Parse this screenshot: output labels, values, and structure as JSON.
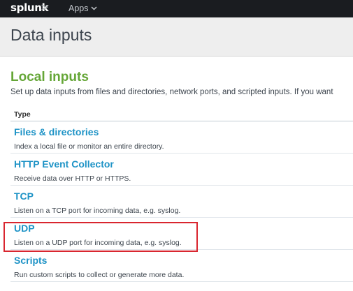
{
  "topbar": {
    "logo": "splunk",
    "logo_chevron": ">",
    "apps_label": "Apps"
  },
  "page": {
    "title": "Data inputs"
  },
  "local_inputs": {
    "heading": "Local inputs",
    "description": "Set up data inputs from files and directories, network ports, and scripted inputs. If you want",
    "column_header": "Type",
    "rows": [
      {
        "title": "Files & directories",
        "description": "Index a local file or monitor an entire directory."
      },
      {
        "title": "HTTP Event Collector",
        "description": "Receive data over HTTP or HTTPS."
      },
      {
        "title": "TCP",
        "description": "Listen on a TCP port for incoming data, e.g. syslog."
      },
      {
        "title": "UDP",
        "description": "Listen on a UDP port for incoming data, e.g. syslog."
      },
      {
        "title": "Scripts",
        "description": "Run custom scripts to collect or generate more data."
      }
    ]
  },
  "colors": {
    "topbar_bg": "#1a1c20",
    "heading_green": "#65a637",
    "link_blue": "#1e93c6",
    "highlight_red": "#d9262f"
  }
}
